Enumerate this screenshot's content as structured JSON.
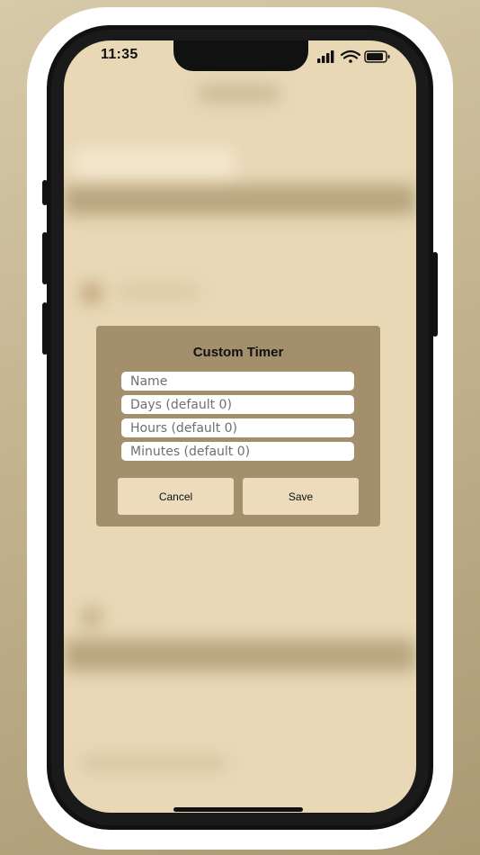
{
  "status_bar": {
    "time": "11:35",
    "icons": [
      "cellular-signal-icon",
      "wifi-icon",
      "battery-icon"
    ]
  },
  "dialog": {
    "title": "Custom Timer",
    "fields": {
      "name": {
        "value": "",
        "placeholder": "Name"
      },
      "days": {
        "value": "",
        "placeholder": "Days (default 0)"
      },
      "hours": {
        "value": "",
        "placeholder": "Hours (default 0)"
      },
      "minutes": {
        "value": "",
        "placeholder": "Minutes (default 0)"
      }
    },
    "buttons": {
      "cancel": "Cancel",
      "save": "Save"
    }
  },
  "colors": {
    "background": "#e8d8b6",
    "dialog": "#a38f6c",
    "button": "#ecdcbc",
    "frame": "#111111"
  }
}
